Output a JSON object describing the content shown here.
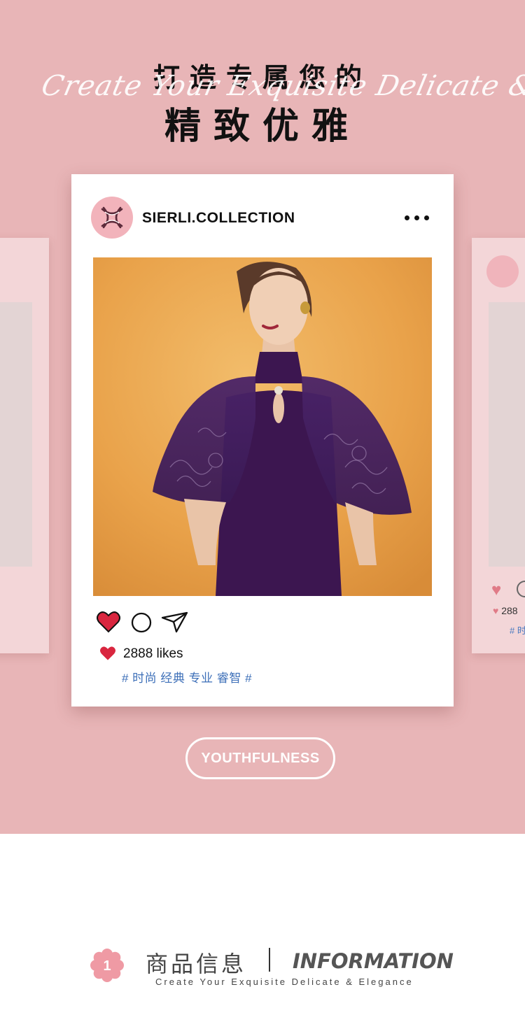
{
  "header": {
    "line1": "打造专属您的",
    "script": "Create Your Exquisite Delicate & Elegance",
    "line2": "精致优雅"
  },
  "post": {
    "username": "SIERLI.COLLECTION",
    "more_icon": "more-dots-icon",
    "likes_text": "2888 likes",
    "tags": "# 时尚 经典 专业 睿智 #",
    "actions": [
      "heart-icon",
      "comment-icon",
      "share-icon"
    ]
  },
  "side_card_right": {
    "likes_text": "288",
    "tag_text": "# 时"
  },
  "badge": {
    "label": "YOUTHFULNESS"
  },
  "info": {
    "number": "1",
    "cn_title": "商品信息",
    "en_title": "INFORMATION",
    "subtitle": "Create Your Exquisite Delicate & Elegance"
  },
  "colors": {
    "background_pink": "#e8b5b7",
    "heart_red": "#d9263f",
    "tag_blue": "#3d6fb8",
    "card_white": "#ffffff"
  }
}
